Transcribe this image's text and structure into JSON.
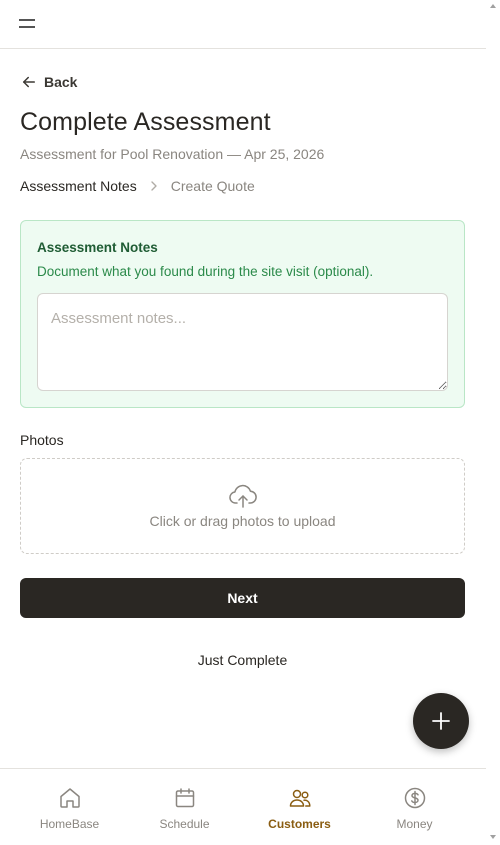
{
  "header": {
    "menu_icon": "hamburger-menu-icon"
  },
  "back": {
    "label": "Back",
    "icon": "arrow-left-icon"
  },
  "page": {
    "title": "Complete Assessment",
    "subtitle": "Assessment for Pool Renovation — Apr 25, 2026"
  },
  "steps": [
    {
      "label": "Assessment Notes",
      "active": true
    },
    {
      "label": "Create Quote",
      "active": false
    }
  ],
  "notes": {
    "title": "Assessment Notes",
    "help": "Document what you found during the site visit (optional).",
    "value": "",
    "placeholder": "Assessment notes..."
  },
  "photos": {
    "label": "Photos",
    "upload_text": "Click or drag photos to upload",
    "icon": "cloud-upload-icon"
  },
  "actions": {
    "next_label": "Next",
    "just_complete_label": "Just Complete",
    "fab_icon": "plus-icon"
  },
  "nav": {
    "items": [
      {
        "label": "HomeBase",
        "icon": "home-icon",
        "active": false
      },
      {
        "label": "Schedule",
        "icon": "calendar-icon",
        "active": false
      },
      {
        "label": "Customers",
        "icon": "users-icon",
        "active": true
      },
      {
        "label": "Money",
        "icon": "dollar-circle-icon",
        "active": false
      }
    ]
  },
  "colors": {
    "primary": "#2a2723",
    "accent": "#8a5d12",
    "notes_bg": "#eefbf2",
    "notes_border": "#b9e6c6",
    "notes_title": "#1f5c34",
    "notes_help": "#2b8a4a"
  }
}
